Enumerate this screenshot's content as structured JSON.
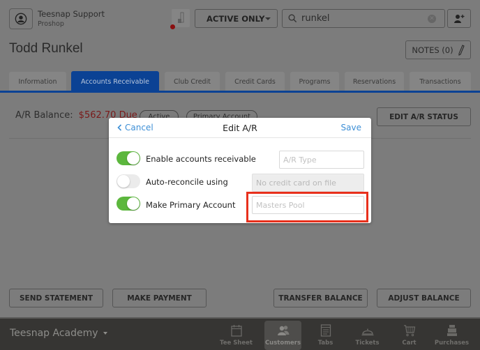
{
  "header": {
    "user_name": "Teesnap Support",
    "user_role": "Proshop",
    "filter": {
      "selected": "ACTIVE ONLY"
    },
    "search": {
      "value": "runkel",
      "placeholder": "Search"
    }
  },
  "customer": {
    "name": "Todd Runkel",
    "notes_label": "NOTES (0)"
  },
  "tabs": [
    {
      "label": "Information",
      "active": false
    },
    {
      "label": "Accounts Receivable",
      "active": true
    },
    {
      "label": "Club Credit",
      "active": false
    },
    {
      "label": "Credit Cards",
      "active": false
    },
    {
      "label": "Programs",
      "active": false
    },
    {
      "label": "Reservations",
      "active": false
    },
    {
      "label": "Transactions",
      "active": false
    }
  ],
  "ar": {
    "balance_label": "A/R Balance:",
    "balance_value": "$562.70 Due",
    "badges": [
      "Active",
      "Primary Account"
    ],
    "edit_status_label": "EDIT A/R STATUS"
  },
  "actions": {
    "send_statement": "SEND STATEMENT",
    "make_payment": "MAKE PAYMENT",
    "transfer_balance": "TRANSFER BALANCE",
    "adjust_balance": "ADJUST BALANCE"
  },
  "nav": {
    "location": "Teesnap Academy",
    "items": [
      {
        "label": "Tee Sheet",
        "icon": "calendar-icon",
        "active": false
      },
      {
        "label": "Customers",
        "icon": "customers-icon",
        "active": true
      },
      {
        "label": "Tabs",
        "icon": "tabs-icon",
        "active": false
      },
      {
        "label": "Tickets",
        "icon": "service-bell-icon",
        "active": false
      },
      {
        "label": "Cart",
        "icon": "cart-icon",
        "active": false
      },
      {
        "label": "Purchases",
        "icon": "cash-register-icon",
        "active": false
      }
    ]
  },
  "modal": {
    "title": "Edit A/R",
    "cancel_label": "Cancel",
    "save_label": "Save",
    "rows": [
      {
        "label": "Enable accounts receivable",
        "toggle_on": true,
        "input_placeholder": "A/R Type",
        "input_value": "",
        "disabled": false
      },
      {
        "label": "Auto-reconcile using",
        "toggle_on": false,
        "input_placeholder": "No credit card on file",
        "input_value": "",
        "disabled": true
      },
      {
        "label": "Make Primary Account",
        "toggle_on": true,
        "input_placeholder": "Masters Pool",
        "input_value": "",
        "disabled": false
      }
    ]
  },
  "colors": {
    "accent_blue": "#0b4294",
    "link_blue": "#3d8fd6",
    "toggle_green": "#5cb73d",
    "balance_due_red": "#7a1a1a",
    "highlight_red": "#e8301c"
  }
}
